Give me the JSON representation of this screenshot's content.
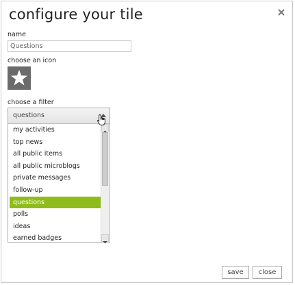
{
  "dialog": {
    "title": "configure your tile",
    "close_icon": "close-icon"
  },
  "name_field": {
    "label": "name",
    "value": "Questions"
  },
  "icon_picker": {
    "label": "choose an icon",
    "icon": "star-icon"
  },
  "filter": {
    "label": "choose a filter",
    "selected": "questions",
    "options": [
      "my activities",
      "top news",
      "all public items",
      "all public microblogs",
      "private messages",
      "follow-up",
      "questions",
      "polls",
      "ideas",
      "earned badges"
    ],
    "highlighted_index": 6
  },
  "buttons": {
    "save": "save",
    "close": "close"
  },
  "colors": {
    "highlight": "#8fbc1b",
    "icon_bg": "#6b6b6b"
  }
}
